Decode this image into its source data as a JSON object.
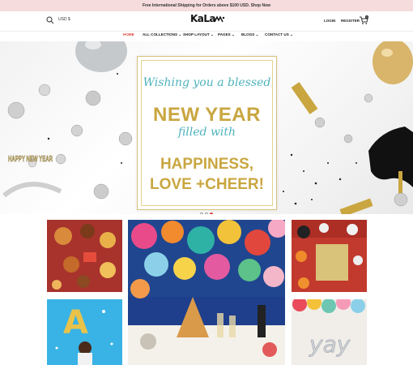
{
  "announcement": "Free International Shipping for Orders above $100 USD. Shop Now",
  "header": {
    "currency": "USD $",
    "logo": "KaLa",
    "login": "LOGIN",
    "register": "REGISTER",
    "cart_count": "0"
  },
  "nav": [
    {
      "label": "HOME",
      "active": true
    },
    {
      "label": "ALL COLLECTIONS ⌄"
    },
    {
      "label": "SHOP LAYOUT ⌄"
    },
    {
      "label": "PAGES ⌄"
    },
    {
      "label": "BLOGS ⌄"
    },
    {
      "label": "CONTACT US ⌄"
    }
  ],
  "hero": {
    "line1": "Wishing you a blessed",
    "line2": "NEW YEAR",
    "line3": "filled with",
    "line4a": "HAPPINESS,",
    "line4b": "LOVE +CHEER!",
    "tiara_text": "HAPPY NEW YEAR",
    "slides": 3,
    "active_slide": 3
  },
  "gallery": {
    "balloon_letter": "A",
    "garland_text": "yay"
  },
  "colors": {
    "accent": "#e0433a",
    "topbar_bg": "#f6dcdc",
    "teal": "#4fb3bd",
    "gold": "#c9a640"
  }
}
